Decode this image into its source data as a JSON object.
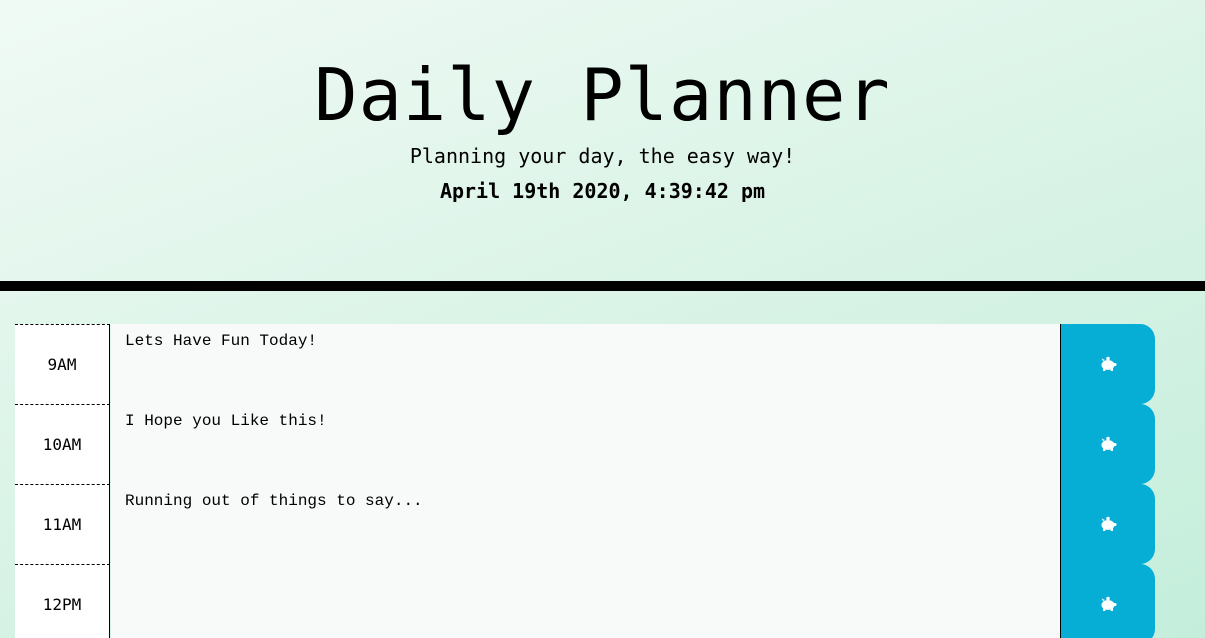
{
  "header": {
    "title": "Daily Planner",
    "subtitle": "Planning your day, the easy way!",
    "current_day": "April 19th 2020, 4:39:42 pm"
  },
  "colors": {
    "save_button": "#06aed5",
    "row_background": "#f7faf9"
  },
  "rows": [
    {
      "hour": "9AM",
      "text": "Lets Have Fun Today!",
      "save_icon": "piggy-bank-icon"
    },
    {
      "hour": "10AM",
      "text": "I Hope you Like this!",
      "save_icon": "piggy-bank-icon"
    },
    {
      "hour": "11AM",
      "text": "Running out of things to say...",
      "save_icon": "piggy-bank-icon"
    },
    {
      "hour": "12PM",
      "text": "",
      "save_icon": "piggy-bank-icon"
    }
  ]
}
